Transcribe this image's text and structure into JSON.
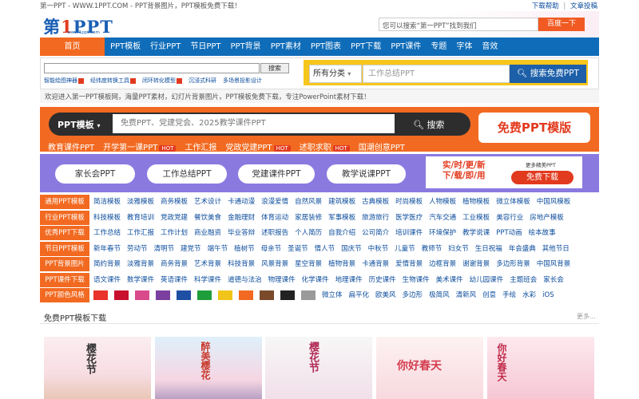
{
  "topbar": {
    "site_text": "第一PPT - WWW.1PPT.COM - PPT背景图片，PPT模板免费下载！",
    "help": "下载帮助",
    "submit": "文章投稿",
    "sep": "|"
  },
  "logo": {
    "text_a": "第",
    "text_b": "1",
    "text_c": "PPT",
    "sub": "www.1ppt.com"
  },
  "top_search": {
    "placeholder": "您可以搜索“第一PPT”找到我们",
    "button": "百度一下"
  },
  "nav": {
    "home": "首页",
    "items": [
      "PPT模板",
      "行业PPT",
      "节日PPT",
      "PPT背景",
      "PPT素材",
      "PPT图表",
      "PPT下载",
      "PPT课件",
      "专题",
      "字体",
      "音效"
    ]
  },
  "small_search": {
    "button": "搜索"
  },
  "hotwords": [
    "智能绘图神器",
    "经纬度转换工具",
    "闭环转化模型",
    "沉浸式科研",
    "多场景投影设计"
  ],
  "main_search": {
    "category": "所有分类",
    "category_arrow": "▾",
    "placeholder": "工作总结PPT",
    "button": "搜索免费PPT"
  },
  "welcome": "欢迎进入第一PPT模板网，海量PPT素材，幻灯片背景图片，PPT模板免费下载，专注PowerPoint素材下载！",
  "banner1": {
    "category": "PPT模板",
    "placeholder": "免费PPT、党建党会、2025教学课件PPT",
    "search": "搜索",
    "free": "免费PPT模版",
    "links": [
      {
        "t": "教育课件PPT",
        "hot": ""
      },
      {
        "t": "开学第一课PPT",
        "hot": "HOT"
      },
      {
        "t": "工作汇报",
        "hot": ""
      },
      {
        "t": "党政党建PPT",
        "hot": "HOT"
      },
      {
        "t": "述职求职",
        "hot": "HOT"
      },
      {
        "t": "国潮创意PPT",
        "hot": ""
      }
    ]
  },
  "banner2": {
    "pills": [
      "家长会PPT",
      "工作总结PPT",
      "党建课件PPT",
      "教学说课PPT"
    ],
    "red1": "实/时/更/新",
    "red2": "下/载/即/用",
    "more": "更多精美PPT",
    "download": "免费下载"
  },
  "categories": [
    {
      "head": "通用PPT模板",
      "links": [
        "简洁模板",
        "淡雅模板",
        "商务模板",
        "艺术设计",
        "卡通动漫",
        "浪漫爱情",
        "自然风景",
        "建筑模板",
        "古典模板",
        "时尚模板",
        "人物模板",
        "植物模板",
        "微立体模板",
        "中国风模板"
      ]
    },
    {
      "head": "行业PPT模板",
      "links": [
        "科技模板",
        "教育培训",
        "党政党建",
        "餐饮美食",
        "金融理财",
        "体育运动",
        "家居装修",
        "军事模板",
        "旅游旅行",
        "医学医疗",
        "汽车交通",
        "工业模板",
        "美容行业",
        "房地产模板"
      ]
    },
    {
      "head": "优秀PPT下载",
      "links": [
        "工作总结",
        "工作汇报",
        "工作计划",
        "商业融资",
        "毕业答辩",
        "述职报告",
        "个人简历",
        "自我介绍",
        "公司简介",
        "培训课件",
        "环境保护",
        "教学说课",
        "PPT动画",
        "绘本故事"
      ]
    },
    {
      "head": "节日PPT模板",
      "links": [
        "新年春节",
        "劳动节",
        "清明节",
        "建党节",
        "端午节",
        "植树节",
        "母亲节",
        "圣诞节",
        "情人节",
        "国庆节",
        "中秋节",
        "儿童节",
        "教师节",
        "妇女节",
        "生日祝福",
        "年会盛典",
        "其他节日"
      ]
    },
    {
      "head": "PPT背景图片",
      "links": [
        "简约背景",
        "淡雅背景",
        "商务背景",
        "艺术背景",
        "科技背景",
        "风景背景",
        "星空背景",
        "植物背景",
        "卡通背景",
        "爱情背景",
        "边框背景",
        "谢谢背景",
        "多边形背景",
        "中国风背景"
      ]
    },
    {
      "head": "PPT课件下载",
      "links": [
        "语文课件",
        "数学课件",
        "英语课件",
        "科学课件",
        "道德与法治",
        "物理课件",
        "化学课件",
        "地理课件",
        "历史课件",
        "生物课件",
        "美术课件",
        "幼儿园课件",
        "主题班会",
        "家长会"
      ]
    },
    {
      "head": "PPT颜色风格",
      "links": [
        "微立体",
        "扁平化",
        "欧美风",
        "多边形",
        "极简风",
        "清新风",
        "创意",
        "手绘",
        "水彩",
        "iOS"
      ]
    }
  ],
  "colors": {
    "swatches": [
      "#e8342a",
      "#c8102e",
      "#d94a8c",
      "#7b3fa0",
      "#1f4fa3",
      "#1e9e3a",
      "#f0c419",
      "#f26a21",
      "#7a4a2b",
      "#222222",
      "#9a9a9a"
    ],
    "nav": "#0f6cb8",
    "accent": "#f26a21"
  },
  "free_section": {
    "title": "免费PPT模板下载",
    "more": "更多..."
  },
  "thumbs": [
    {
      "t": "樱花节"
    },
    {
      "t": "醉美樱花"
    },
    {
      "t": "樱花节"
    },
    {
      "t": "你好春天"
    },
    {
      "t": "你好春天"
    }
  ]
}
